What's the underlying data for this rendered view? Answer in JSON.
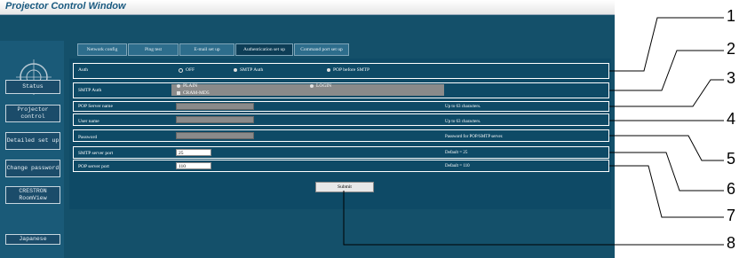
{
  "window": {
    "title": "Projector Control Window"
  },
  "sidebar": {
    "items": [
      {
        "label": "Status"
      },
      {
        "label": "Projector control"
      },
      {
        "label": "Detailed set up"
      },
      {
        "label": "Change password"
      },
      {
        "label": "CRESTRON RoomView"
      },
      {
        "label": "Japanese"
      }
    ]
  },
  "tabs": [
    {
      "label": "Network config"
    },
    {
      "label": "Ping test"
    },
    {
      "label": "E-mail set up"
    },
    {
      "label": "Authentication set up"
    },
    {
      "label": "Command port set up"
    }
  ],
  "form": {
    "auth": {
      "label": "Auth",
      "options": [
        "OFF",
        "SMTP Auth",
        "POP before SMTP"
      ]
    },
    "smtp_auth": {
      "label": "SMTP Auth",
      "options": [
        "PLAIN",
        "LOGIN",
        "CRAM-MD5"
      ]
    },
    "pop_server": {
      "label": "POP Server name",
      "note": "Up to 63 characters."
    },
    "user_name": {
      "label": "User name",
      "note": "Up to 63 characters."
    },
    "password": {
      "label": "Password",
      "note": "Password for POP/SMTP server."
    },
    "smtp_port": {
      "label": "SMTP server port",
      "value": "25",
      "note": "Default = 25"
    },
    "pop_port": {
      "label": "POP server port",
      "value": "110",
      "note": "Default = 110"
    },
    "submit_label": "Submit"
  },
  "callouts": [
    "1",
    "2",
    "3",
    "4",
    "5",
    "6",
    "7",
    "8"
  ]
}
